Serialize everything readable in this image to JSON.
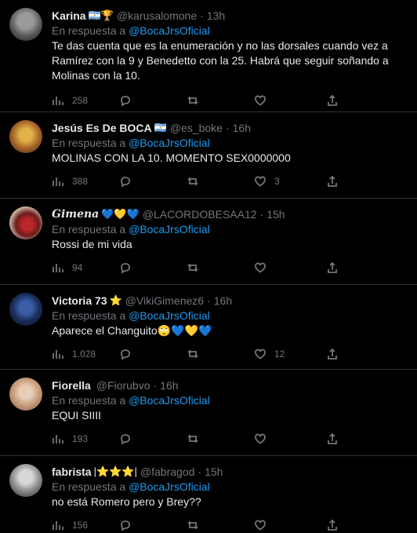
{
  "colors": {
    "link": "#1d9bf0",
    "muted": "#71767b",
    "text": "#e7e9ea",
    "border": "#2f3336"
  },
  "icons": [
    "views-icon",
    "reply-icon",
    "retweet-icon",
    "like-icon",
    "share-icon"
  ],
  "tweets": [
    {
      "name": "Karina",
      "badges": "🇦🇷🏆",
      "handle": "@karusalomone",
      "dot": "·",
      "time": "13h",
      "reply_prefix": "En respuesta a",
      "reply_to": "@BocaJrsOficial",
      "text": "Te das cuenta que es la enumeración y no las dorsales cuando vez a Ramírez con la 9 y Benedetto con la 25. Habrá que seguir soñando a Molinas con la 10.",
      "views": "258",
      "likes": ""
    },
    {
      "name": "Jesús Es De BOCA",
      "badges": "🇦🇷",
      "handle": "@es_boke",
      "dot": "·",
      "time": "16h",
      "reply_prefix": "En respuesta a",
      "reply_to": "@BocaJrsOficial",
      "text": "MOLINAS CON LA 10. MOMENTO SEX0000000",
      "views": "388",
      "likes": "3"
    },
    {
      "name": "Gimena",
      "badges": "💙💛💙",
      "handle": "@LACORDOBESAA12",
      "dot": "·",
      "time": "15h",
      "reply_prefix": "En respuesta a",
      "reply_to": "@BocaJrsOficial",
      "text": "Rossi de mi vida",
      "views": "94",
      "likes": ""
    },
    {
      "name": "Victoria 73",
      "badges": "⭐",
      "handle": "@VikiGimenez6",
      "dot": "·",
      "time": "16h",
      "reply_prefix": "En respuesta a",
      "reply_to": "@BocaJrsOficial",
      "text": "Aparece el Changuito🙄💙💛💙",
      "views": "1.028",
      "likes": "12"
    },
    {
      "name": "Fiorella",
      "badges": "",
      "handle": "@Fiorubvo",
      "dot": "·",
      "time": "16h",
      "reply_prefix": "En respuesta a",
      "reply_to": "@BocaJrsOficial",
      "text": "EQUI SIIII",
      "views": "193",
      "likes": ""
    },
    {
      "name": "fabrista",
      "badges": "|⭐⭐⭐|",
      "handle": "@fabragod",
      "dot": "·",
      "time": "15h",
      "reply_prefix": "En respuesta a",
      "reply_to": "@BocaJrsOficial",
      "text": "no está Romero pero y Brey??",
      "views": "156",
      "likes": ""
    }
  ]
}
